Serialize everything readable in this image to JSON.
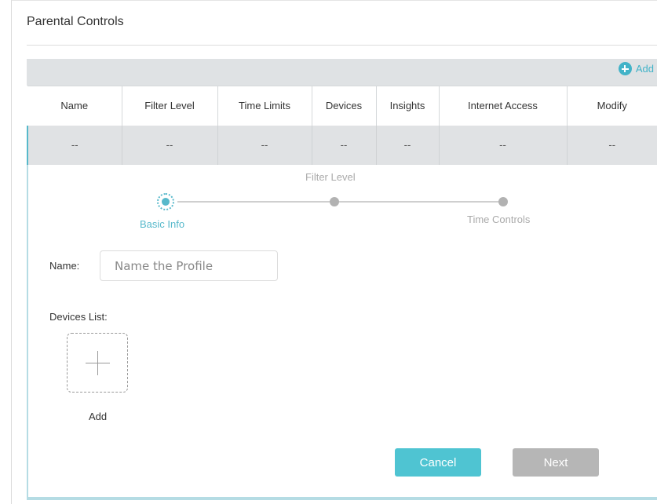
{
  "header": {
    "title": "Parental Controls"
  },
  "toolbar": {
    "add_label": "Add",
    "add_icon": "plus-circle-icon"
  },
  "table": {
    "columns": [
      "Name",
      "Filter Level",
      "Time Limits",
      "Devices",
      "Insights",
      "Internet Access",
      "Modify"
    ],
    "rows": [
      [
        "--",
        "--",
        "--",
        "--",
        "--",
        "--",
        "--"
      ]
    ]
  },
  "stepper": {
    "steps": [
      "Basic Info",
      "Filter Level",
      "Time Controls"
    ],
    "active_index": 0
  },
  "form": {
    "name_label": "Name:",
    "name_placeholder": "Name the Profile",
    "name_value": "",
    "devices_label": "Devices List:",
    "add_device_label": "Add"
  },
  "actions": {
    "cancel_label": "Cancel",
    "next_label": "Next"
  },
  "colors": {
    "accent": "#4fc4d2",
    "disabled": "#b6b6b6",
    "table_header_bg": "#dfe2e4"
  }
}
